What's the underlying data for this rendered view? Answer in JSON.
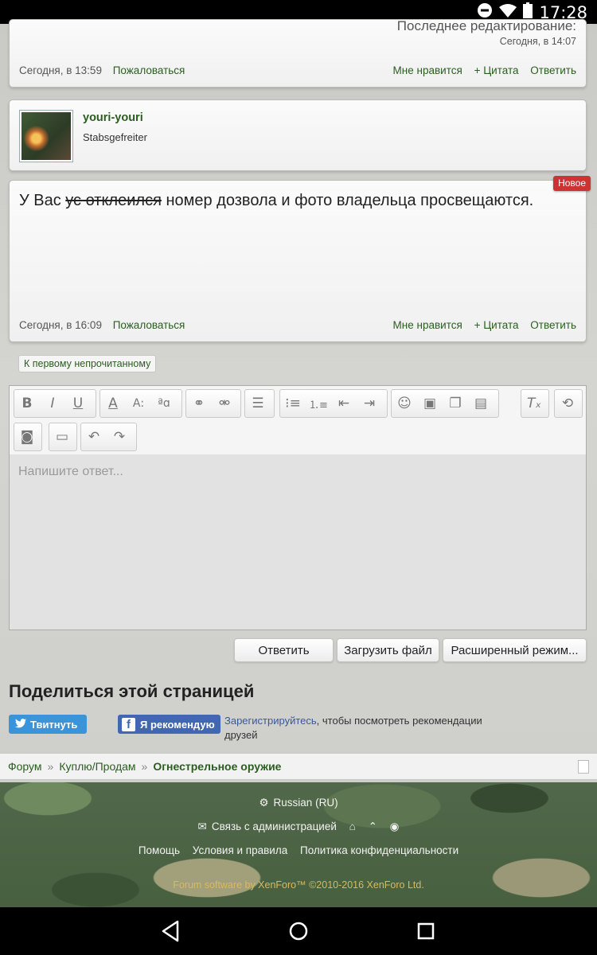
{
  "status_bar": {
    "time": "17:28"
  },
  "prev_post": {
    "edited_label": "Последнее редактирование:",
    "edited_time": "Сегодня, в 14:07",
    "date": "Сегодня, в 13:59",
    "report": "Пожаловаться",
    "like": "Мне нравится",
    "quote": "+ Цитата",
    "reply": "Ответить"
  },
  "user": {
    "name": "youri-youri",
    "title": "Stabsgefreiter"
  },
  "post": {
    "badge": "Новое",
    "text_before": "У Вас ",
    "text_struck": "ус отклеился",
    "text_after": " номер дозвола и фото владельца просвещаются.",
    "date": "Сегодня, в 16:09",
    "report": "Пожаловаться",
    "like": "Мне нравится",
    "quote": "+ Цитата",
    "reply": "Ответить"
  },
  "unread_button": "К первому непрочитанному",
  "editor": {
    "placeholder": "Напишите ответ..."
  },
  "buttons": {
    "reply": "Ответить",
    "upload": "Загрузить файл",
    "advanced": "Расширенный режим..."
  },
  "share": {
    "title": "Поделиться этой страницей",
    "tweet": "Твитнуть",
    "recommend": "Я рекомендую",
    "register_link": "Зарегистрируйтесь",
    "register_rest": ", чтобы посмотреть рекомендации друзей"
  },
  "breadcrumb": {
    "items": [
      "Форум",
      "Куплю/Продам"
    ],
    "current": "Огнестрельное оружие"
  },
  "footer": {
    "language": "Russian (RU)",
    "contact": "Связь с администрацией",
    "links": [
      "Помощь",
      "Условия и правила",
      "Политика конфиденциальности"
    ],
    "copyright": "Forum software by XenForo™ ©2010-2016 XenForo Ltd."
  }
}
